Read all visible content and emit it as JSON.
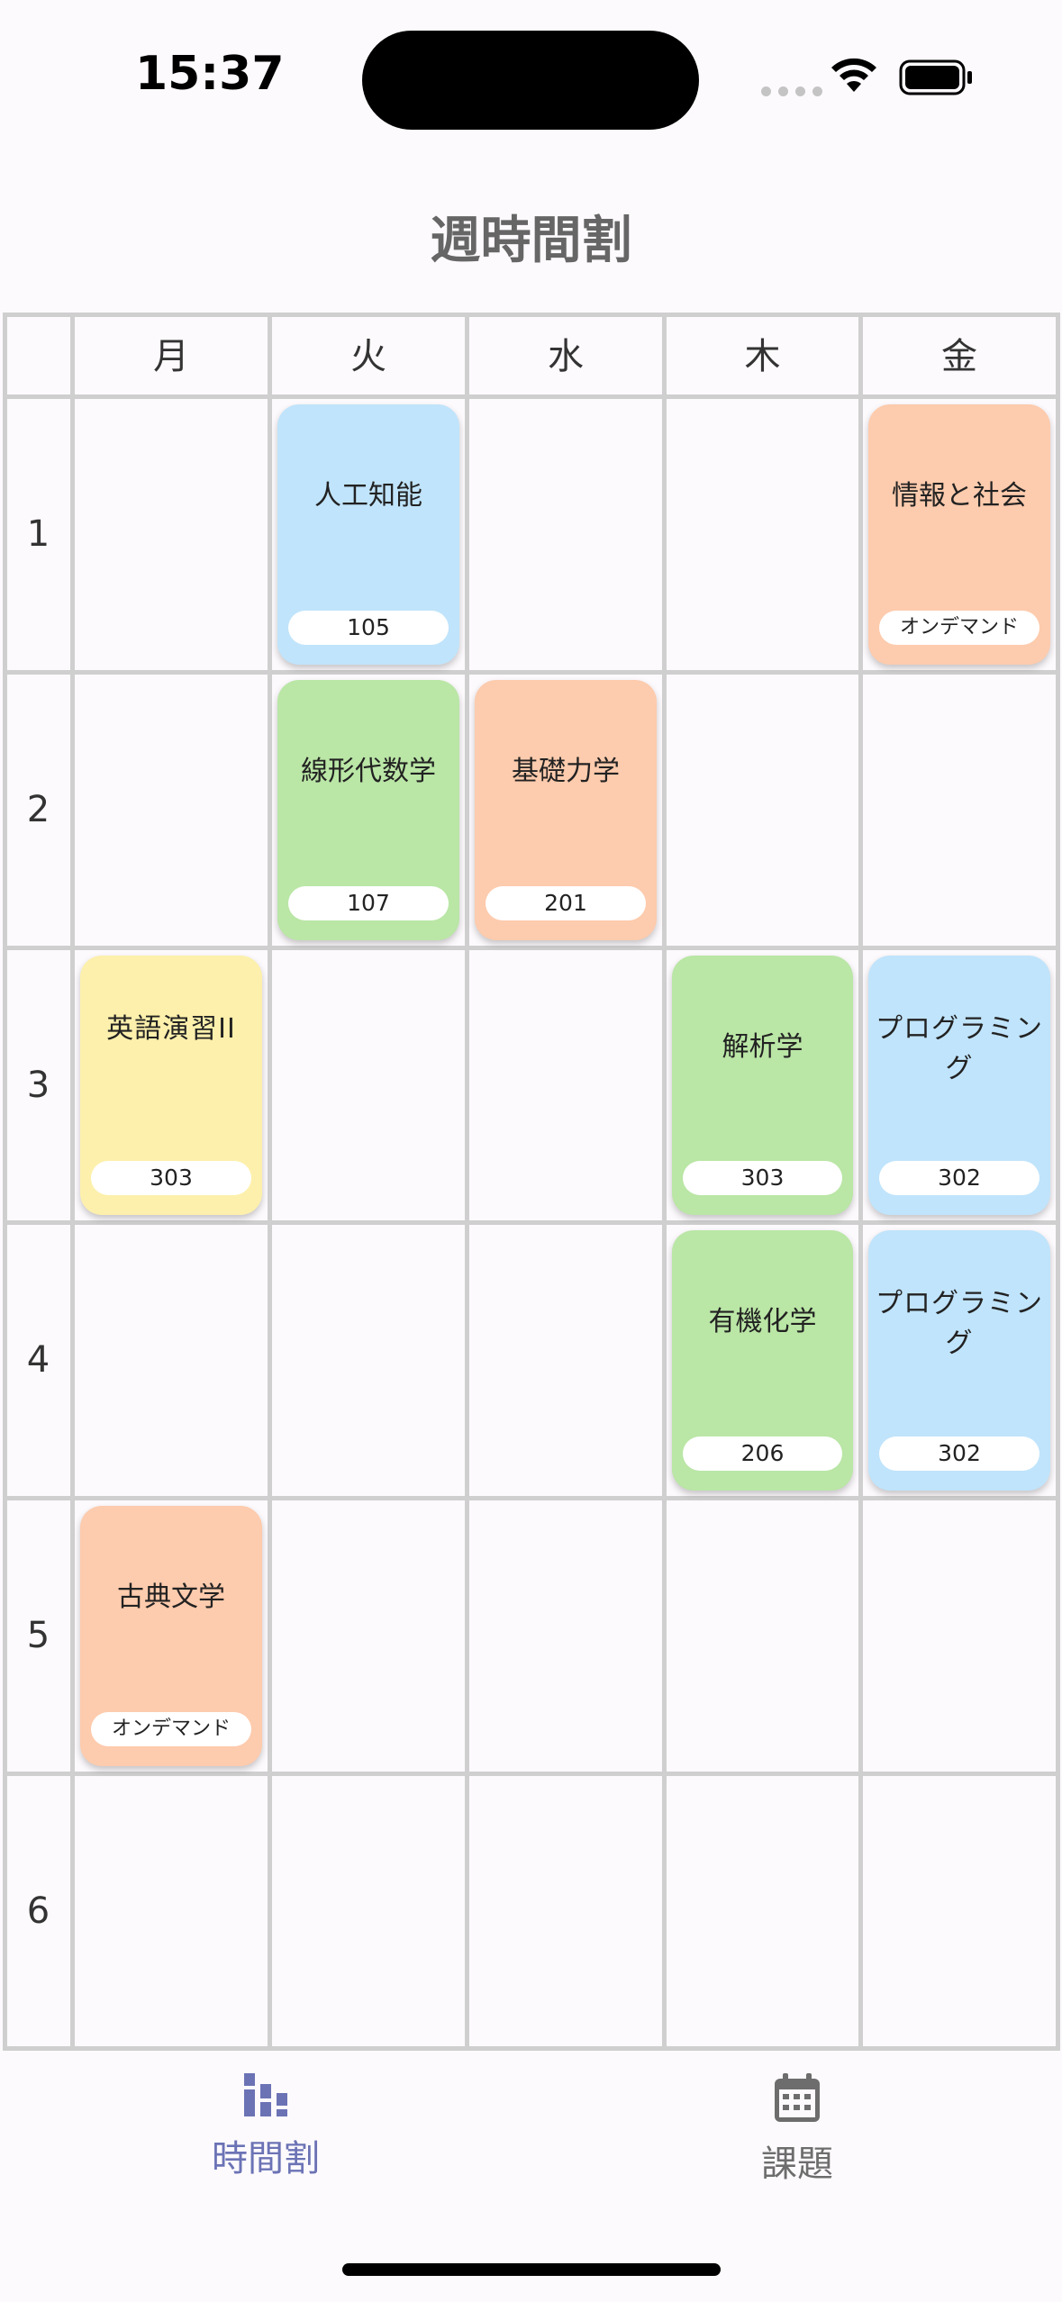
{
  "status_bar": {
    "time": "15:37"
  },
  "title": "週時間割",
  "days": [
    "月",
    "火",
    "水",
    "木",
    "金"
  ],
  "periods": [
    "1",
    "2",
    "3",
    "4",
    "5",
    "6"
  ],
  "colors": {
    "blue": "#c0e4fb",
    "green": "#bae6a6",
    "orange": "#fdcbad",
    "yellow": "#fdf0ac",
    "accent": "#6b73b5",
    "inactive": "#6d6d6d"
  },
  "courses": [
    {
      "name": "人工知能",
      "room": "105",
      "day": 1,
      "period": 0,
      "color": "#c0e4fb"
    },
    {
      "name": "情報と社会",
      "room": "オンデマンド",
      "day": 4,
      "period": 0,
      "color": "#fdcbad"
    },
    {
      "name": "線形代数学",
      "room": "107",
      "day": 1,
      "period": 1,
      "color": "#bae6a6"
    },
    {
      "name": "基礎力学",
      "room": "201",
      "day": 2,
      "period": 1,
      "color": "#fdcbad"
    },
    {
      "name": "英語演習II",
      "room": "303",
      "day": 0,
      "period": 2,
      "color": "#fdf0ac"
    },
    {
      "name": "解析学",
      "room": "303",
      "day": 3,
      "period": 2,
      "color": "#bae6a6"
    },
    {
      "name": "プログラミング",
      "room": "302",
      "day": 4,
      "period": 2,
      "color": "#c0e4fb"
    },
    {
      "name": "有機化学",
      "room": "206",
      "day": 3,
      "period": 3,
      "color": "#bae6a6"
    },
    {
      "name": "プログラミング",
      "room": "302",
      "day": 4,
      "period": 3,
      "color": "#c0e4fb"
    },
    {
      "name": "古典文学",
      "room": "オンデマンド",
      "day": 0,
      "period": 4,
      "color": "#fdcbad"
    }
  ],
  "tabs": [
    {
      "label": "時間割",
      "icon": "bar-chart-icon",
      "active": true
    },
    {
      "label": "課題",
      "icon": "calendar-icon",
      "active": false
    }
  ]
}
